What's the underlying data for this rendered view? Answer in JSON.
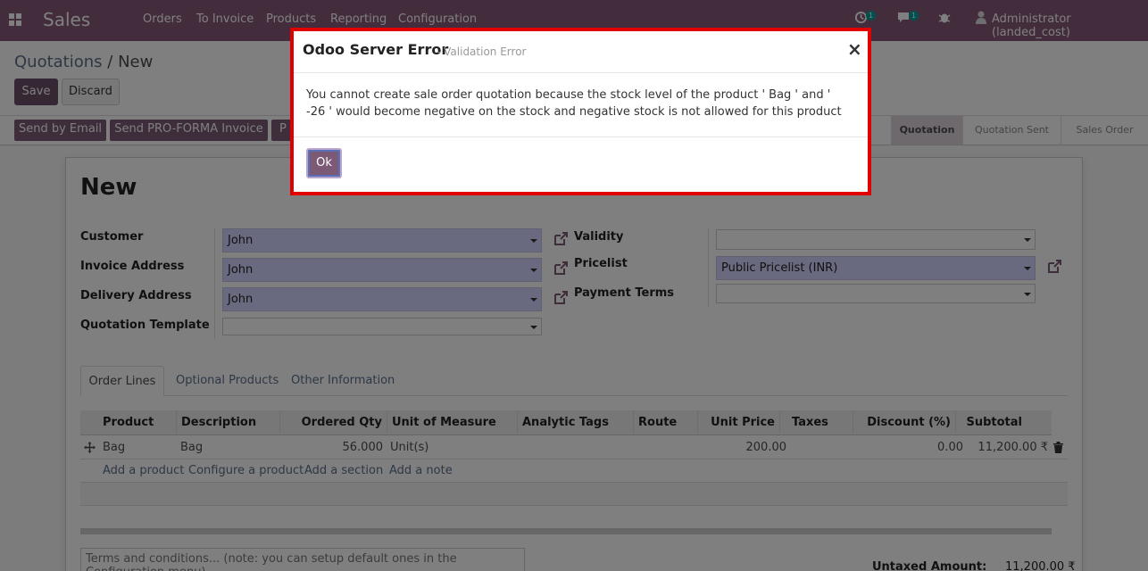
{
  "navbar": {
    "app_name": "Sales",
    "menu": [
      "Orders",
      "To Invoice",
      "Products",
      "Reporting",
      "Configuration"
    ],
    "activity_count": "1",
    "messages_count": "1",
    "user": "Administrator (landed_cost)"
  },
  "control": {
    "breadcrumb_parent": "Quotations",
    "breadcrumb_sep": "/",
    "breadcrumb_current": "New",
    "save_label": "Save",
    "discard_label": "Discard"
  },
  "statusbar": {
    "buttons": [
      "Send by Email",
      "Send PRO-FORMA Invoice",
      "P"
    ],
    "stages": [
      "Quotation",
      "Quotation Sent",
      "Sales Order"
    ],
    "active_stage": "Quotation"
  },
  "form": {
    "title": "New",
    "customer_label": "Customer",
    "customer_value": "John",
    "invoice_address_label": "Invoice Address",
    "invoice_address_value": "John",
    "delivery_address_label": "Delivery Address",
    "delivery_address_value": "John",
    "quotation_template_label": "Quotation Template",
    "quotation_template_value": "",
    "validity_label": "Validity",
    "validity_value": "",
    "pricelist_label": "Pricelist",
    "pricelist_value": "Public Pricelist (INR)",
    "payment_terms_label": "Payment Terms",
    "payment_terms_value": ""
  },
  "tabs": [
    "Order Lines",
    "Optional Products",
    "Other Information"
  ],
  "order_lines": {
    "columns": [
      "Product",
      "Description",
      "Ordered Qty",
      "Unit of Measure",
      "Analytic Tags",
      "Route",
      "Unit Price",
      "Taxes",
      "Discount (%)",
      "Subtotal"
    ],
    "rows": [
      {
        "product": "Bag",
        "description": "Bag",
        "ordered_qty": "56.000",
        "uom": "Unit(s)",
        "analytic_tags": "",
        "route": "",
        "unit_price": "200.00",
        "taxes": "",
        "discount": "0.00",
        "subtotal": "11,200.00 ₹"
      }
    ],
    "add_links": [
      "Add a product",
      "Configure a product",
      "Add a section",
      "Add a note"
    ]
  },
  "terms_placeholder": "Terms and conditions... (note: you can setup default ones in the Configuration menu)",
  "totals": {
    "untaxed_label": "Untaxed Amount:",
    "untaxed_value": "11,200.00 ₹"
  },
  "dialog": {
    "title": "Odoo Server Error",
    "subtitle": "- Validation Error",
    "close": "×",
    "message": "You cannot create sale order quotation because the stock level of the product ' Bag ' and ' -26 ' would become negative on the stock and negative stock is not allowed for this product",
    "ok_label": "Ok"
  },
  "colors": {
    "brand": "#875a7b",
    "primary_button": "#6c4f68",
    "required_field": "#d2d2ff",
    "dialog_border": "#e00000"
  }
}
